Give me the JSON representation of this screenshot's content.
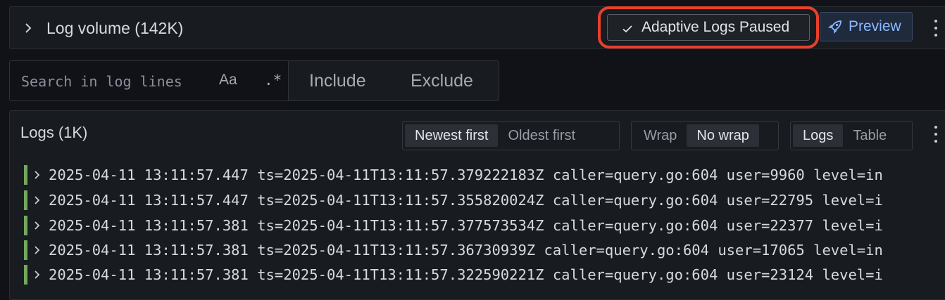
{
  "log_volume": {
    "title": "Log volume (142K)",
    "adaptive_logs_label": "Adaptive Logs Paused",
    "preview_label": "Preview"
  },
  "search": {
    "placeholder": "Search in log lines",
    "case_toggle": "Aa",
    "regex_toggle": ".*",
    "include_label": "Include",
    "exclude_label": "Exclude"
  },
  "logs": {
    "title": "Logs (1K)",
    "sort": {
      "newest": "Newest first",
      "oldest": "Oldest first",
      "selected": "Newest first"
    },
    "wrap": {
      "wrap": "Wrap",
      "nowrap": "No wrap",
      "selected": "No wrap"
    },
    "view": {
      "logs": "Logs",
      "table": "Table",
      "selected": "Logs"
    },
    "level_color": "#73a85d",
    "lines": [
      {
        "text": "2025-04-11 13:11:57.447 ts=2025-04-11T13:11:57.379222183Z caller=query.go:604 user=9960 level=in"
      },
      {
        "text": "2025-04-11 13:11:57.447 ts=2025-04-11T13:11:57.355820024Z caller=query.go:604 user=22795 level=i"
      },
      {
        "text": "2025-04-11 13:11:57.381 ts=2025-04-11T13:11:57.377573534Z caller=query.go:604 user=22377 level=i"
      },
      {
        "text": "2025-04-11 13:11:57.381 ts=2025-04-11T13:11:57.36730939Z caller=query.go:604 user=17065 level=in"
      },
      {
        "text": "2025-04-11 13:11:57.381 ts=2025-04-11T13:11:57.322590221Z caller=query.go:604 user=23124 level=i"
      }
    ]
  },
  "colors": {
    "background": "#111217",
    "panel": "#181b1f",
    "highlight_ring": "#e8402b",
    "preview_text": "#8ab8ff"
  }
}
